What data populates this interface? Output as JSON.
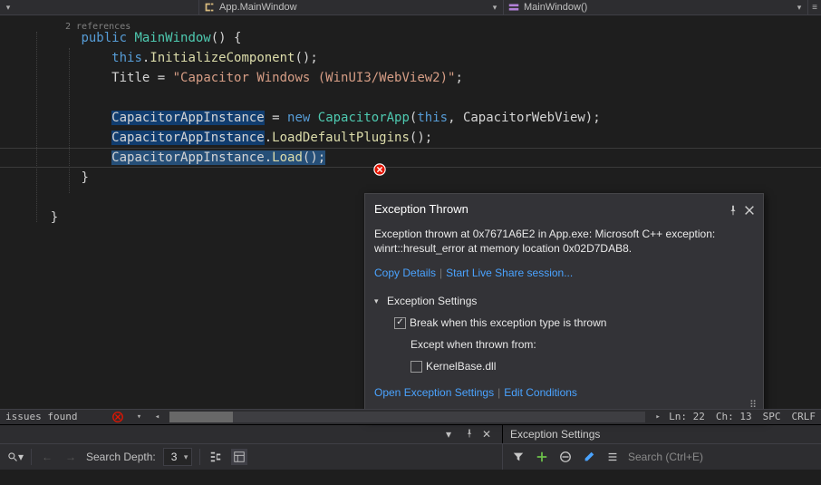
{
  "nav": {
    "cls_label": "App.MainWindow",
    "member_label": "MainWindow()"
  },
  "editor": {
    "refs_hint": "2 references",
    "tokens": {
      "public": "public",
      "ctor": "MainWindow",
      "brace_o": "{",
      "brace_c": "}",
      "this": "this",
      "init": "InitializeComponent",
      "title": "Title",
      "eq": " = ",
      "title_str": "\"Capacitor Windows (WinUI3/WebView2)\"",
      "cap_inst": "CapacitorAppInstance",
      "new": "new",
      "cap_app": "CapacitorApp",
      "this_arg": "this",
      "webview": "CapacitorWebView",
      "load_def": "LoadDefaultPlugins",
      "load": "Load"
    }
  },
  "popup": {
    "title": "Exception Thrown",
    "message": "Exception thrown at 0x7671A6E2 in App.exe: Microsoft C++ exception: winrt::hresult_error at memory location 0x02D7DAB8.",
    "copy": "Copy Details",
    "live": "Start Live Share session...",
    "settings_header": "Exception Settings",
    "break_when": "Break when this exception type is thrown",
    "except_from": "Except when thrown from:",
    "module": "KernelBase.dll",
    "open_settings": "Open Exception Settings",
    "edit_cond": "Edit Conditions"
  },
  "status": {
    "issues": "issues found",
    "ln": "Ln: 22",
    "ch": "Ch: 13",
    "spc": "SPC",
    "crlf": "CRLF"
  },
  "tool_panel": {
    "title": "Exception Settings"
  },
  "bottom": {
    "search_depth_label": "Search Depth:",
    "search_depth_value": "3",
    "search_placeholder": "Search (Ctrl+E)"
  }
}
